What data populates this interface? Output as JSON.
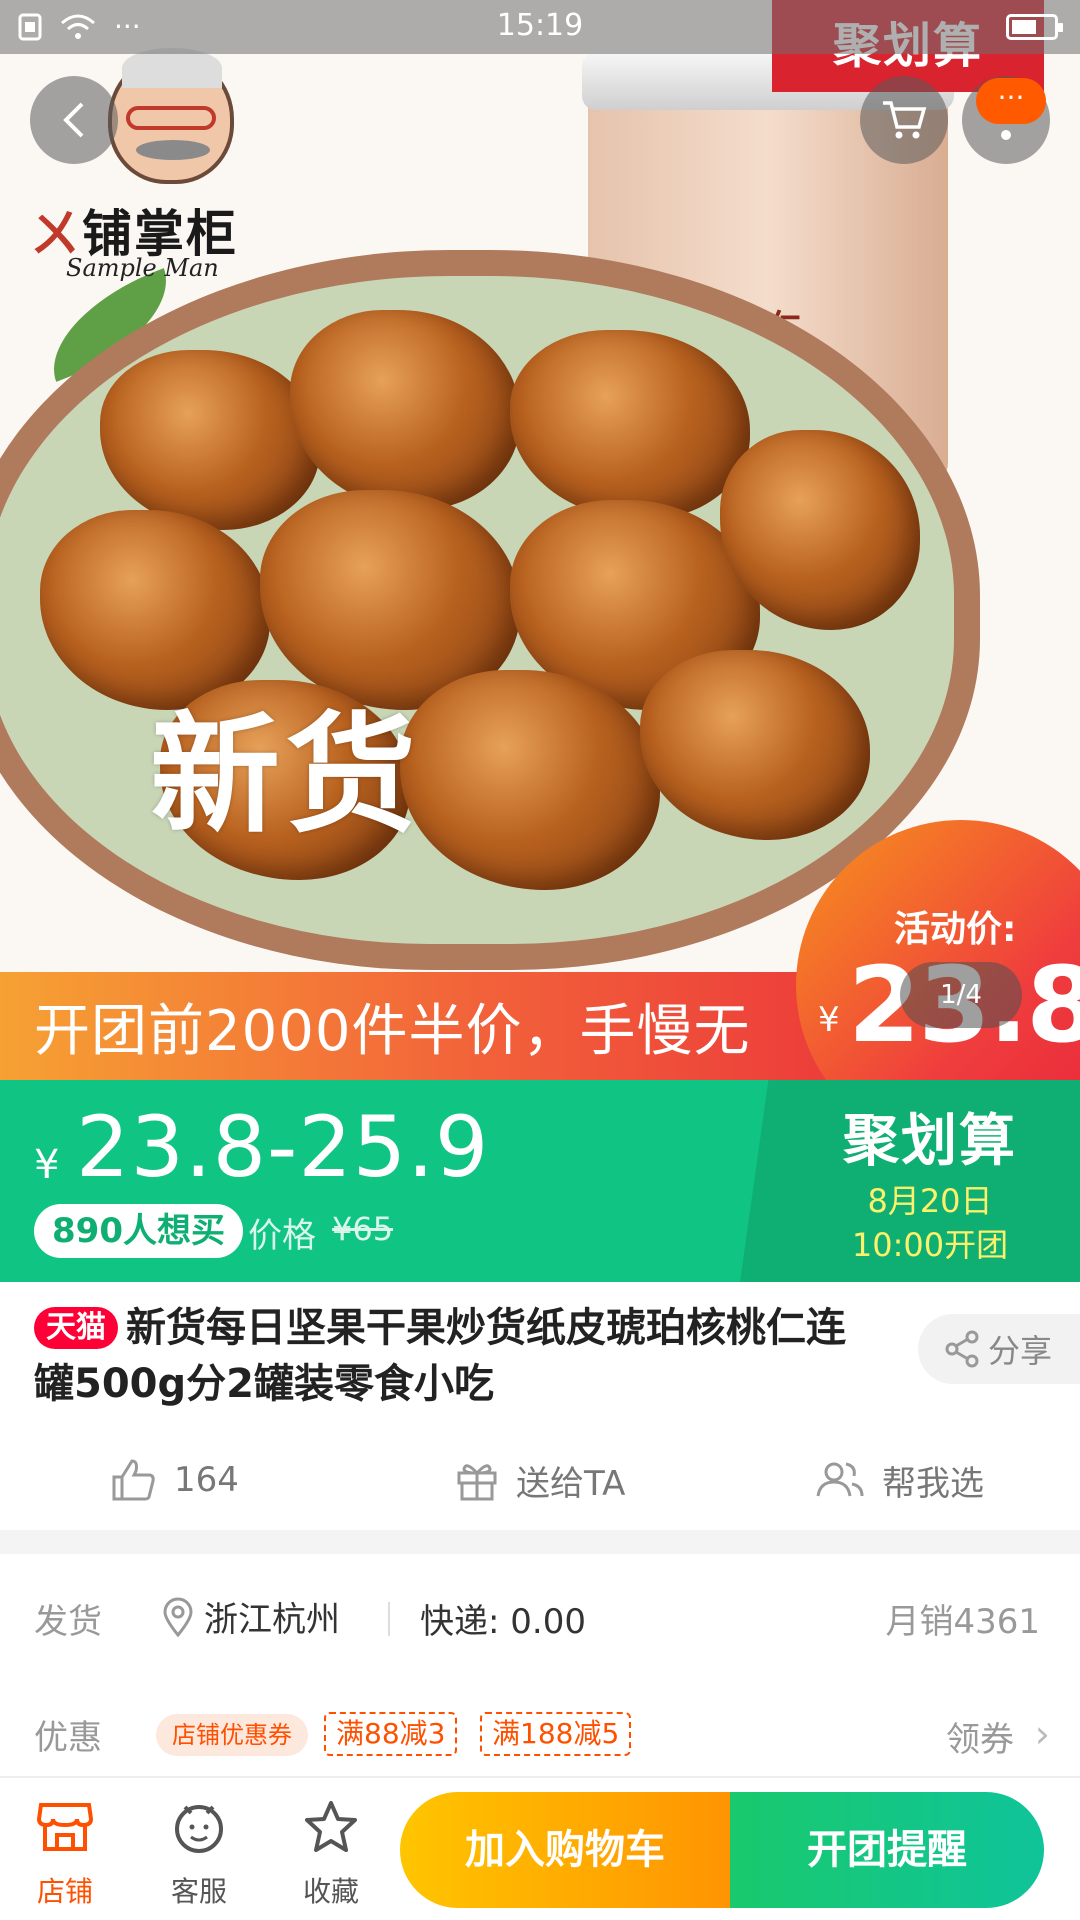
{
  "status_bar": {
    "time": "15:19",
    "dots": "···"
  },
  "hero": {
    "brand_name": "铺掌柜",
    "brand_en": "Sample Man",
    "corner_badge": "聚划算",
    "jar_label": "琥珀桃仁",
    "overlay_text": "新货",
    "banner_text": "开团前2000件半价，手慢无",
    "promo_label": "活动价:",
    "promo_yen": "¥",
    "promo_price": "23.8",
    "pager": "1/4",
    "more_badge": "···"
  },
  "price_bar": {
    "yen": "¥",
    "range": "23.8-25.9",
    "want_count": "890人想买",
    "orig_label": "价格",
    "orig_price": "¥65",
    "jhs_title": "聚划算",
    "jhs_date": "8月20日",
    "jhs_time": "10:00开团"
  },
  "product": {
    "tag": "天猫",
    "title": "新货每日坚果干果炒货纸皮琥珀核桃仁连罐500g分2罐装零食小吃",
    "share_label": "分享"
  },
  "actions": {
    "like_count": "164",
    "gift_label": "送给TA",
    "help_label": "帮我选"
  },
  "shipping": {
    "label": "发货",
    "location": "浙江杭州",
    "express": "快递: 0.00",
    "monthly_sales": "月销4361"
  },
  "discount": {
    "label": "优惠",
    "shop_coupon": "店铺优惠券",
    "coupons": [
      "满88减3",
      "满188减5"
    ],
    "get_label": "领券"
  },
  "bottom_bar": {
    "tabs": [
      {
        "label": "店铺",
        "icon": "store-icon"
      },
      {
        "label": "客服",
        "icon": "customer-service-icon"
      },
      {
        "label": "收藏",
        "icon": "star-icon"
      }
    ],
    "add_cart": "加入购物车",
    "remind": "开团提醒"
  },
  "colors": {
    "accent_orange": "#ff5000",
    "tmall_red": "#ff0036",
    "green": "#10c483",
    "yellow_text": "#fdf06b"
  }
}
